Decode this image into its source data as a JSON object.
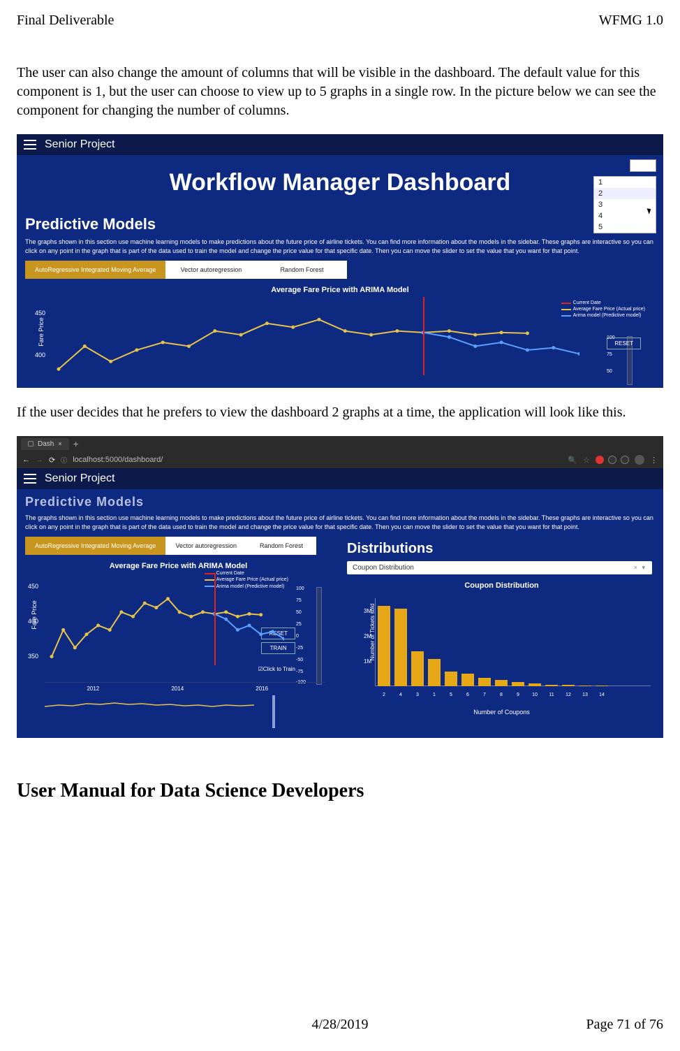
{
  "header": {
    "left": "Final Deliverable",
    "right": "WFMG 1.0"
  },
  "para1": "The user can also change the amount of columns that will be visible in the dashboard. The default value for this component is 1, but the user can choose to view up to 5 graphs in a single row. In the picture below we can see the component for changing the number of columns.",
  "para2": "If the user decides that he prefers to view the dashboard 2 graphs at a time, the application will look like this.",
  "h2": "User Manual for Data Science Developers",
  "footer": {
    "date": "4/28/2019",
    "page": "Page 71 of 76"
  },
  "s1": {
    "app_title": "Senior Project",
    "hero": "Workflow Manager Dashboard",
    "cols_options": [
      "1",
      "2",
      "3",
      "4",
      "5"
    ],
    "section_title": "Predictive Models",
    "section_desc": "The graphs shown in this section use machine learning models to make predictions about the future price of airline tickets. You can find more information about the models in the sidebar. These graphs are interactive so you can click on any point in the graph that is part of the data used to train the model and change the price value for that specific date. Then you can move the slider to set the value that you want for that point.",
    "tabs": [
      "AutoRegressive Integrated Moving Average",
      "Vector autoregression",
      "Random Forest"
    ],
    "chart_title": "Average Fare Price with ARIMA Model",
    "ylabel": "Fare Price",
    "yticks": [
      "450",
      "400"
    ],
    "legend": [
      "Current Date",
      "Average Fare Price (Actual price)",
      "Arima model (Predictive model)"
    ],
    "slider_ticks": [
      "100",
      "75",
      "50"
    ],
    "btn_reset": "RESET"
  },
  "s2": {
    "browser_tab": "Dash",
    "url": "localhost:5000/dashboard/",
    "app_title": "Senior Project",
    "section_title_trunc": "Predictive Models",
    "section_desc": "The graphs shown in this section use machine learning models to make predictions about the future price of airline tickets. You can find more information about the models in the sidebar. These graphs are interactive so you can click on any point in the graph that is part of the data used to train the model and change the price value for that specific date. Then you can move the slider to set the value that you want for that point.",
    "tabs": [
      "AutoRegressive Integrated Moving Average",
      "Vector autoregression",
      "Random Forest"
    ],
    "chart_title": "Average Fare Price with ARIMA Model",
    "ylabel": "Fare Price",
    "yticks": [
      "450",
      "400",
      "350"
    ],
    "legend": [
      "Current Date",
      "Average Fare Price (Actual price)",
      "Arima model (Predictive model)"
    ],
    "slider_ticks": [
      "100",
      "75",
      "50",
      "25",
      "0",
      "-25",
      "-50",
      "-75",
      "-100"
    ],
    "btn_reset": "RESET",
    "btn_train": "TRAIN",
    "click_train": "Click to Train",
    "range_years": [
      "2012",
      "2014",
      "2016"
    ],
    "dist_header": "Distributions",
    "combo_value": "Coupon Distribution",
    "bar_title": "Coupon Distribution",
    "bar_ylabel": "Number of Tickets sold",
    "bar_xlabel": "Number of Coupons"
  },
  "chart_data": [
    {
      "type": "line",
      "title": "Average Fare Price with ARIMA Model",
      "ylabel": "Fare Price",
      "ylim": [
        350,
        460
      ],
      "series": [
        {
          "name": "Average Fare Price (Actual price)",
          "color": "#e6c24a",
          "values": [
            370,
            400,
            380,
            395,
            405,
            400,
            420,
            415,
            430,
            425,
            435,
            420,
            415,
            420,
            418,
            420,
            415,
            418,
            417
          ]
        },
        {
          "name": "Arima model (Predictive model)",
          "color": "#5aa0ff",
          "values": [
            null,
            null,
            null,
            null,
            null,
            null,
            null,
            null,
            null,
            null,
            null,
            null,
            null,
            null,
            418,
            412,
            400,
            405,
            395,
            398,
            390
          ]
        }
      ],
      "current_date_index": 14
    },
    {
      "type": "bar",
      "title": "Coupon Distribution",
      "xlabel": "Number of Coupons",
      "ylabel": "Number of Tickets sold",
      "categories": [
        "2",
        "4",
        "3",
        "1",
        "5",
        "6",
        "7",
        "8",
        "9",
        "10",
        "11",
        "12",
        "13",
        "14"
      ],
      "values_label_unit": "M",
      "yticks": [
        "1M",
        "2M",
        "3M"
      ],
      "values": [
        3.2,
        3.1,
        1.4,
        1.1,
        0.6,
        0.5,
        0.35,
        0.25,
        0.18,
        0.12,
        0.08,
        0.06,
        0.04,
        0.03
      ],
      "ylim": [
        0,
        3.5
      ]
    }
  ]
}
